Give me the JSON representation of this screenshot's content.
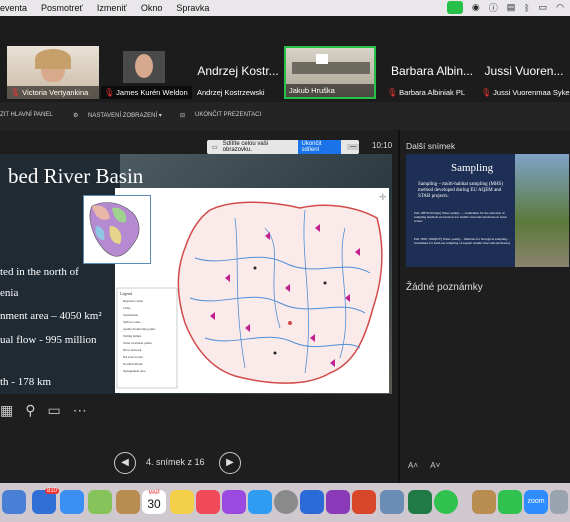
{
  "menubar": {
    "items": [
      "eventa",
      "Posmotreť",
      "Izmeniť",
      "Okno",
      "Spravka"
    ],
    "status_icons": [
      "zoom-camera-icon",
      "badge-29-icon",
      "info-icon",
      "keyboard-layout-icon",
      "bluetooth-icon",
      "battery-icon",
      "wifi-icon"
    ]
  },
  "participants": [
    {
      "name": "Victoria Vertyankina",
      "muted": true
    },
    {
      "name": "James Kurén Weldon",
      "muted": true
    },
    {
      "name": "Andrzej Kostrzewski",
      "display": "Andrzej Kostr...",
      "muted": false
    },
    {
      "name": "Jakub Hruška",
      "muted": false,
      "active": true
    },
    {
      "name": "Barbara Albiniak PL",
      "display": "Barbara Albin...",
      "muted": true
    },
    {
      "name": "Jussi Vuorenmaa Syke",
      "display": "Jussi Vuoren...",
      "muted": true
    }
  ],
  "toolbar": {
    "hide_panel": "ZIT HLAVNÍ PANEL",
    "display_settings": "NASTAVENÍ ZOBRAZENÍ ▾",
    "end_presentation": "UKONČIT PREZENTACI"
  },
  "share_banner": {
    "text": "Sdílíte celou vaši obrazovku.",
    "stop_label": "Ukončit sdílení",
    "min_label": "—"
  },
  "presenter": {
    "time": "10:10",
    "slide_title": "bed River Basin",
    "lines": [
      "ted in the north of",
      "enia",
      "nment area – 4050 km²",
      "ual flow - 995 million",
      "th - 178 km"
    ],
    "legend_title": "Legend",
    "legend": [
      "Regional center",
      "Cities",
      "Settlements",
      "Surface water",
      "quality monitoring points",
      "Tailing dumps",
      "Water treatment plants",
      "River network",
      "RA state border",
      "Northern Basin",
      "management area"
    ],
    "slide_counter": "4. snímek z 16"
  },
  "side": {
    "next_label": "Další snímek",
    "next_title": "Sampling",
    "next_bullets": [
      "Sampling – multi-habitat sampling (MHS) method developed during EU AQEM and STAR projects.",
      "ISO 10870:2012(en) Water quality — Guidelines for the selection of sampling methods and devices for benthic macroinvertebrates in fresh waters",
      "ISO 7828: 1994(E/F) Water quality – Methods for biological sampling – Guidelines for hand-net sampling of aquatic benthic macroinvertebrates)"
    ],
    "notes": "Žádné poznámky",
    "font_controls": [
      "A˄",
      "A˅"
    ]
  },
  "dock": {
    "mail_badge": "810",
    "calendar_month": "МАЙ",
    "calendar_day": "30",
    "zoom_label": "zoom"
  }
}
